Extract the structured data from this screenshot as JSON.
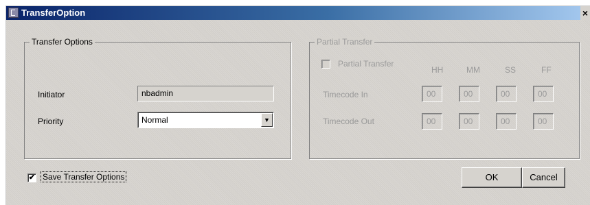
{
  "window": {
    "title": "TransferOption",
    "close_glyph": "×"
  },
  "transfer_options": {
    "legend": "Transfer Options",
    "initiator_label": "Initiator",
    "initiator_value": "nbadmin",
    "priority_label": "Priority",
    "priority_value": "Normal"
  },
  "partial_transfer": {
    "legend": "Partial Transfer",
    "checkbox_label": "Partial Transfer",
    "checked": false,
    "columns": [
      "HH",
      "MM",
      "SS",
      "FF"
    ],
    "timecode_in_label": "Timecode In",
    "timecode_in": [
      "00",
      "00",
      "00",
      "00"
    ],
    "timecode_out_label": "Timecode Out",
    "timecode_out": [
      "00",
      "00",
      "00",
      "00"
    ]
  },
  "save_options": {
    "label": "Save Transfer Options",
    "checked": true,
    "check_glyph": "✔"
  },
  "buttons": {
    "ok": "OK",
    "cancel": "Cancel"
  },
  "icons": {
    "app": "app-window-icon",
    "dropdown": "chevron-down-icon",
    "dropdown_glyph": "▼"
  },
  "colors": {
    "titlebar_start": "#0a246a",
    "titlebar_end": "#a6caf0",
    "face": "#d6d3ce"
  }
}
